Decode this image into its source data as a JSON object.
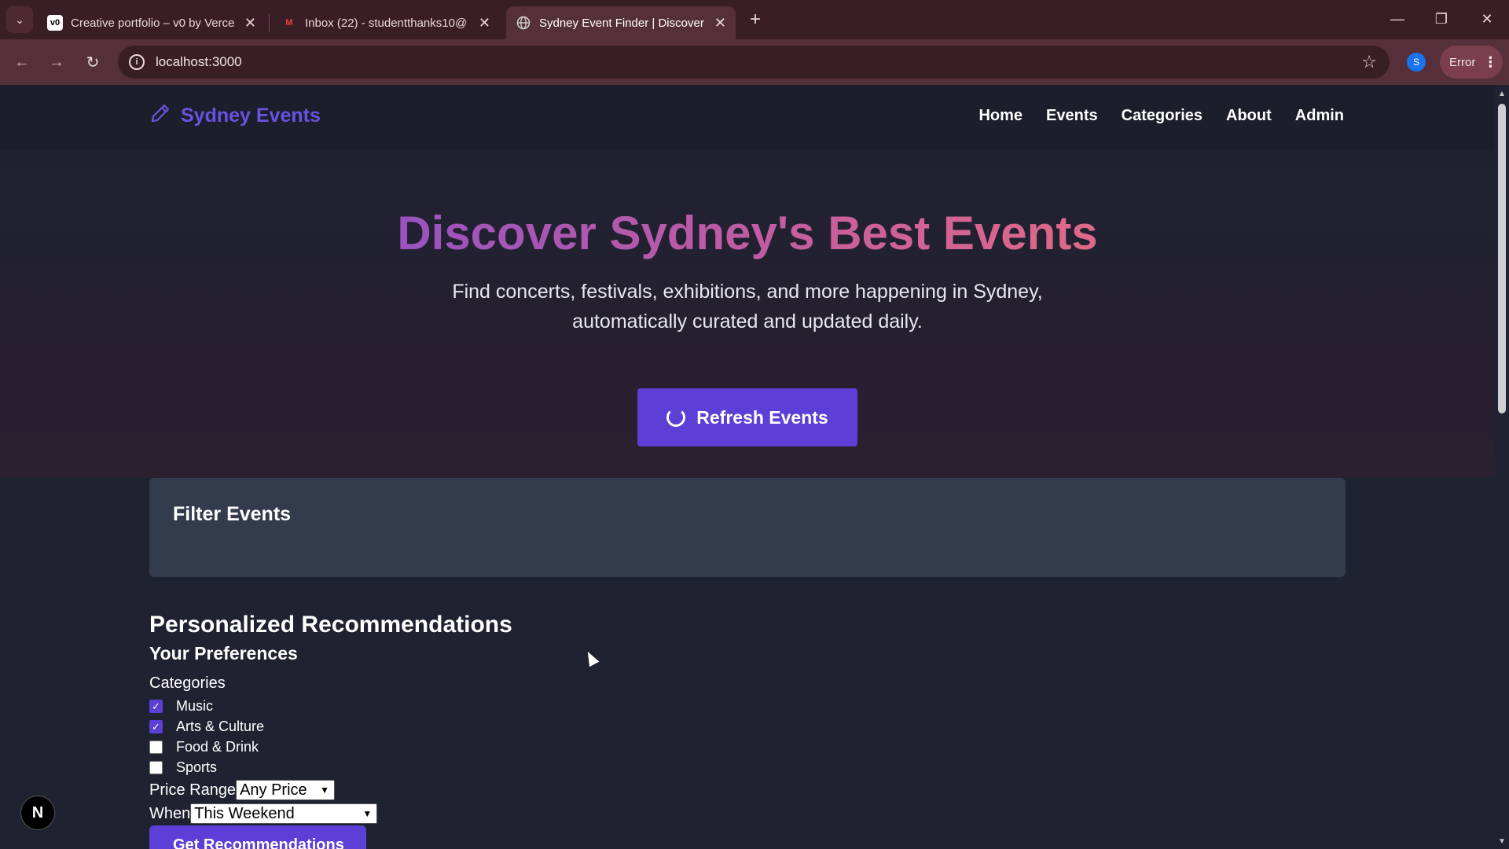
{
  "browser": {
    "tabs": [
      {
        "title": "Creative portfolio – v0 by Verce",
        "favicon": "v0"
      },
      {
        "title": "Inbox (22) - studentthanks10@",
        "favicon": "M"
      },
      {
        "title": "Sydney Event Finder | Discover",
        "favicon": "globe"
      }
    ],
    "url": "localhost:3000",
    "profile_initial": "S",
    "error_label": "Error",
    "accent": "#55303a"
  },
  "site": {
    "logo": "Sydney Events",
    "nav": [
      "Home",
      "Events",
      "Categories",
      "About",
      "Admin"
    ],
    "hero_title": "Discover Sydney's Best Events",
    "hero_subtitle": "Find concerts, festivals, exhibitions, and more happening in Sydney, automatically curated and updated daily.",
    "refresh_label": "Refresh Events",
    "filter_title": "Filter Events",
    "reco_title": "Personalized Recommendations",
    "prefs_title": "Your Preferences",
    "categories_label": "Categories",
    "categories": [
      {
        "label": "Music",
        "checked": true
      },
      {
        "label": "Arts & Culture",
        "checked": true
      },
      {
        "label": "Food & Drink",
        "checked": false
      },
      {
        "label": "Sports",
        "checked": false
      }
    ],
    "price_label": "Price Range",
    "price_value": "Any Price",
    "when_label": "When",
    "when_value": "This Weekend",
    "get_reco_label": "Get Recommendations",
    "brand_color": "#5b3fd6"
  },
  "dev_badge": "N"
}
